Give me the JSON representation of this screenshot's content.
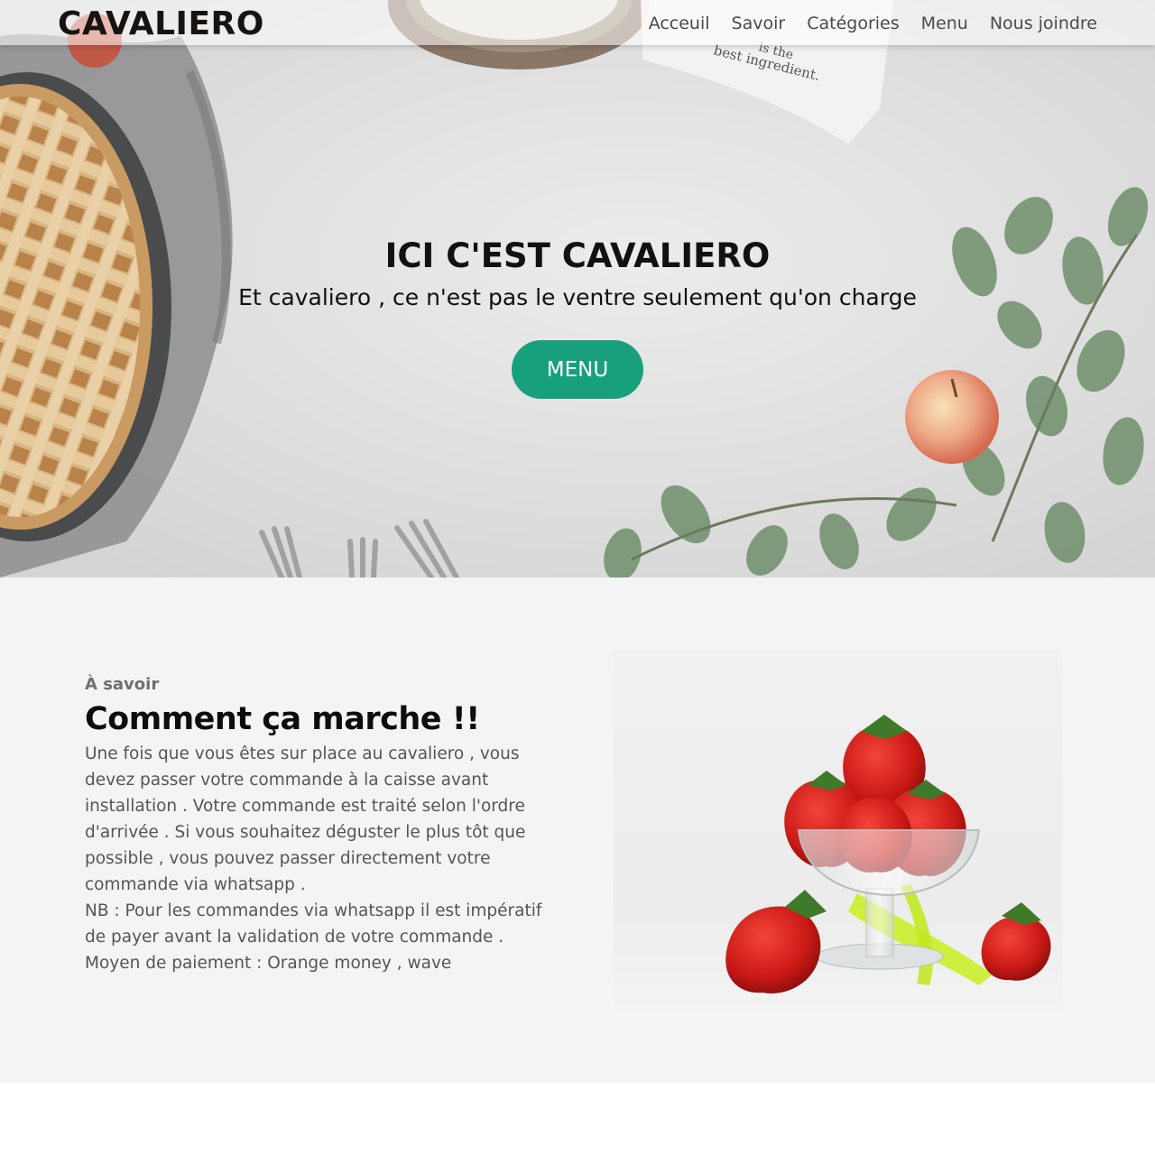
{
  "nav": {
    "brand": "CAVALIERO",
    "links": [
      "Acceuil",
      "Savoir",
      "Catégories",
      "Menu",
      "Nous joindre"
    ]
  },
  "hero": {
    "title": "ICI C'EST CAVALIERO",
    "subtitle": "Et cavaliero , ce n'est pas le ventre seulement qu'on charge",
    "button_label": "MENU",
    "towel_text_1": "is the",
    "towel_text_2": "best ingredient."
  },
  "about": {
    "eyebrow": "À savoir",
    "title": "Comment ça marche !!",
    "body_lines": [
      "Une fois que vous êtes sur place au cavaliero , vous devez passer votre commande à la caisse avant installation . Votre commande est traité selon l'ordre d'arrivée . Si vous souhaitez déguster le plus tôt que possible , vous pouvez passer directement votre commande via whatsapp .",
      "NB : Pour les commandes via whatsapp il est impératif de payer avant la validation de votre commande .",
      "Moyen de paiement : Orange money , wave"
    ]
  },
  "colors": {
    "accent": "#18a07c",
    "section_bg": "#f4f4f6"
  }
}
